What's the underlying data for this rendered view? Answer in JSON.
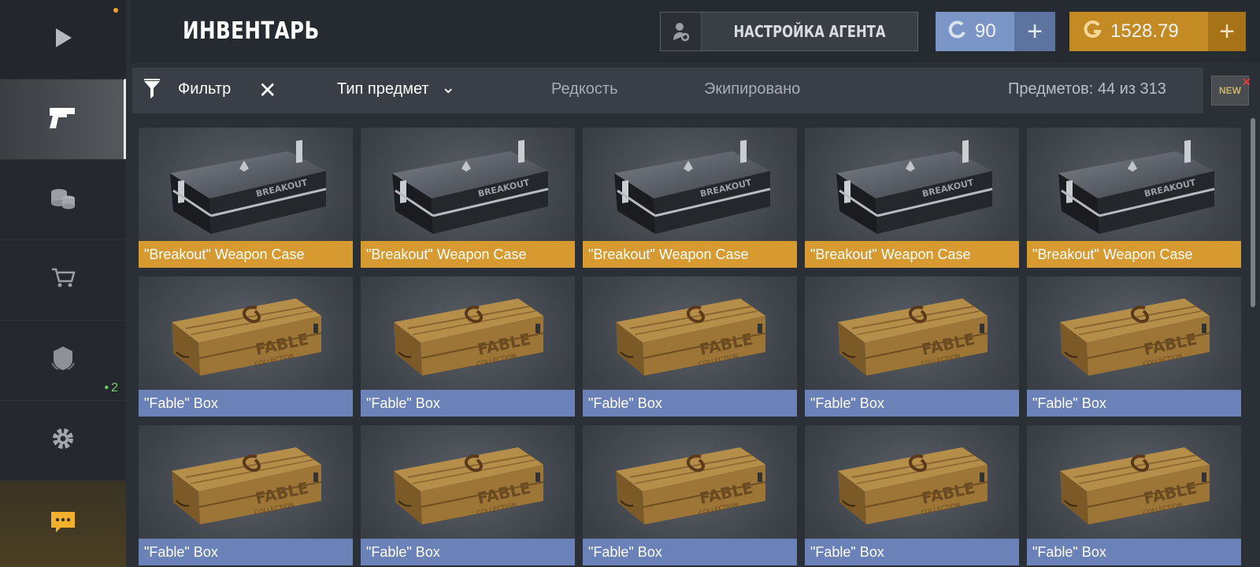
{
  "header": {
    "title": "ИНВЕНТАРЬ",
    "agent_button": "НАСТРОЙКА АГЕНТА",
    "credits": "90",
    "gold": "1528.79",
    "plus": "+"
  },
  "sidebar": {
    "items": [
      {
        "name": "play",
        "icon": "play-icon"
      },
      {
        "name": "weapons",
        "icon": "pistol-icon",
        "active": true
      },
      {
        "name": "coins",
        "icon": "coins-icon"
      },
      {
        "name": "shop",
        "icon": "cart-icon"
      },
      {
        "name": "clan",
        "icon": "shield-icon",
        "badge": "2"
      },
      {
        "name": "settings",
        "icon": "gear-icon"
      },
      {
        "name": "chat",
        "icon": "chat-icon"
      }
    ]
  },
  "filter_bar": {
    "filter_label": "Фильтр",
    "close": "✕",
    "type_label": "Тип предмет",
    "chevron": "⌄",
    "rarity_label": "Редкость",
    "equipped_label": "Экипировано",
    "count_label": "Предметов: 44 из 313",
    "new_label": "NEW",
    "new_close": "✕"
  },
  "items": [
    {
      "name": "\"Breakout\" Weapon Case",
      "kind": "case",
      "rarity": "gold"
    },
    {
      "name": "\"Breakout\" Weapon Case",
      "kind": "case",
      "rarity": "gold"
    },
    {
      "name": "\"Breakout\" Weapon Case",
      "kind": "case",
      "rarity": "gold"
    },
    {
      "name": "\"Breakout\" Weapon Case",
      "kind": "case",
      "rarity": "gold"
    },
    {
      "name": "\"Breakout\" Weapon Case",
      "kind": "case",
      "rarity": "gold"
    },
    {
      "name": "\"Fable\" Box",
      "kind": "box",
      "rarity": "blue"
    },
    {
      "name": "\"Fable\" Box",
      "kind": "box",
      "rarity": "blue"
    },
    {
      "name": "\"Fable\" Box",
      "kind": "box",
      "rarity": "blue"
    },
    {
      "name": "\"Fable\" Box",
      "kind": "box",
      "rarity": "blue"
    },
    {
      "name": "\"Fable\" Box",
      "kind": "box",
      "rarity": "blue"
    },
    {
      "name": "\"Fable\" Box",
      "kind": "box",
      "rarity": "blue"
    },
    {
      "name": "\"Fable\" Box",
      "kind": "box",
      "rarity": "blue"
    },
    {
      "name": "\"Fable\" Box",
      "kind": "box",
      "rarity": "blue"
    },
    {
      "name": "\"Fable\" Box",
      "kind": "box",
      "rarity": "blue"
    },
    {
      "name": "\"Fable\" Box",
      "kind": "box",
      "rarity": "blue"
    }
  ],
  "case_art_text": {
    "brand": "BREAKOUT",
    "box_brand": "FABLE",
    "box_sub": "COLLECTION"
  },
  "colors": {
    "accent_gold": "#d69a30",
    "rarity_blue": "#6a82b8",
    "credits_blue": "#7b95c6",
    "gold_currency": "#c48a23"
  }
}
